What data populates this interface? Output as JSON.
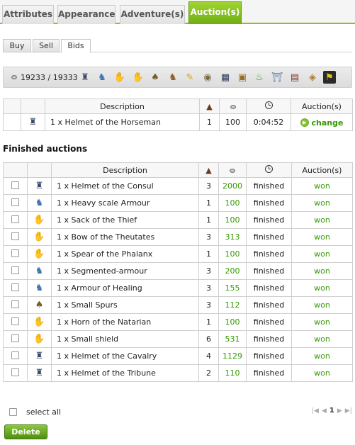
{
  "main_tabs": [
    {
      "label": "Attributes",
      "active": false
    },
    {
      "label": "Appearance",
      "active": false
    },
    {
      "label": "Adventure(s)",
      "active": false
    },
    {
      "label": "Auction(s)",
      "active": true
    }
  ],
  "sub_tabs": [
    {
      "label": "Buy",
      "active": false
    },
    {
      "label": "Sell",
      "active": false
    },
    {
      "label": "Bids",
      "active": true
    }
  ],
  "filter_bar": {
    "gold": "19233 / 19333",
    "category_icons": [
      "helmet-icon",
      "armour-icon",
      "glove-icon",
      "hand-icon",
      "boots-icon",
      "horse-icon",
      "scroll-icon",
      "bag-icon",
      "chest-icon",
      "box-icon",
      "potion-icon",
      "bucket-icon",
      "book-icon",
      "map-icon",
      "banner-icon"
    ]
  },
  "active_table": {
    "headers": {
      "description": "Description",
      "auction": "Auction(s)"
    },
    "rows": [
      {
        "icon": "helmet-icon",
        "description": "1 x Helmet of the Horseman",
        "count": "1",
        "price": "100",
        "time": "0:04:52",
        "action": "change"
      }
    ]
  },
  "finished": {
    "title": "Finished auctions",
    "headers": {
      "description": "Description",
      "auction": "Auction(s)"
    },
    "rows": [
      {
        "icon": "helmet-icon",
        "description": "1 x Helmet of the Consul",
        "count": "3",
        "price": "2000",
        "status": "finished",
        "result": "won"
      },
      {
        "icon": "armour-icon",
        "description": "1 x Heavy scale Armour",
        "count": "1",
        "price": "100",
        "status": "finished",
        "result": "won"
      },
      {
        "icon": "hand-icon",
        "description": "1 x Sack of the Thief",
        "count": "1",
        "price": "100",
        "status": "finished",
        "result": "won"
      },
      {
        "icon": "hand-icon",
        "description": "1 x Bow of the Theutates",
        "count": "3",
        "price": "313",
        "status": "finished",
        "result": "won"
      },
      {
        "icon": "hand-icon",
        "description": "1 x Spear of the Phalanx",
        "count": "1",
        "price": "100",
        "status": "finished",
        "result": "won"
      },
      {
        "icon": "armour-icon",
        "description": "1 x Segmented-armour",
        "count": "3",
        "price": "200",
        "status": "finished",
        "result": "won"
      },
      {
        "icon": "armour-icon",
        "description": "1 x Armour of Healing",
        "count": "3",
        "price": "155",
        "status": "finished",
        "result": "won"
      },
      {
        "icon": "spurs-icon",
        "description": "1 x Small Spurs",
        "count": "3",
        "price": "112",
        "status": "finished",
        "result": "won"
      },
      {
        "icon": "hand-icon",
        "description": "1 x Horn of the Natarian",
        "count": "1",
        "price": "100",
        "status": "finished",
        "result": "won"
      },
      {
        "icon": "hand-icon",
        "description": "1 x Small shield",
        "count": "6",
        "price": "531",
        "status": "finished",
        "result": "won"
      },
      {
        "icon": "helmet-icon",
        "description": "1 x Helmet of the Cavalry",
        "count": "4",
        "price": "1129",
        "status": "finished",
        "result": "won"
      },
      {
        "icon": "helmet-icon",
        "description": "1 x Helmet of the Tribune",
        "count": "2",
        "price": "110",
        "status": "finished",
        "result": "won"
      }
    ]
  },
  "footer": {
    "select_all": "select all",
    "page": "1",
    "delete": "Delete"
  },
  "colors": {
    "accent": "#7bbf1e",
    "won": "#339900"
  }
}
